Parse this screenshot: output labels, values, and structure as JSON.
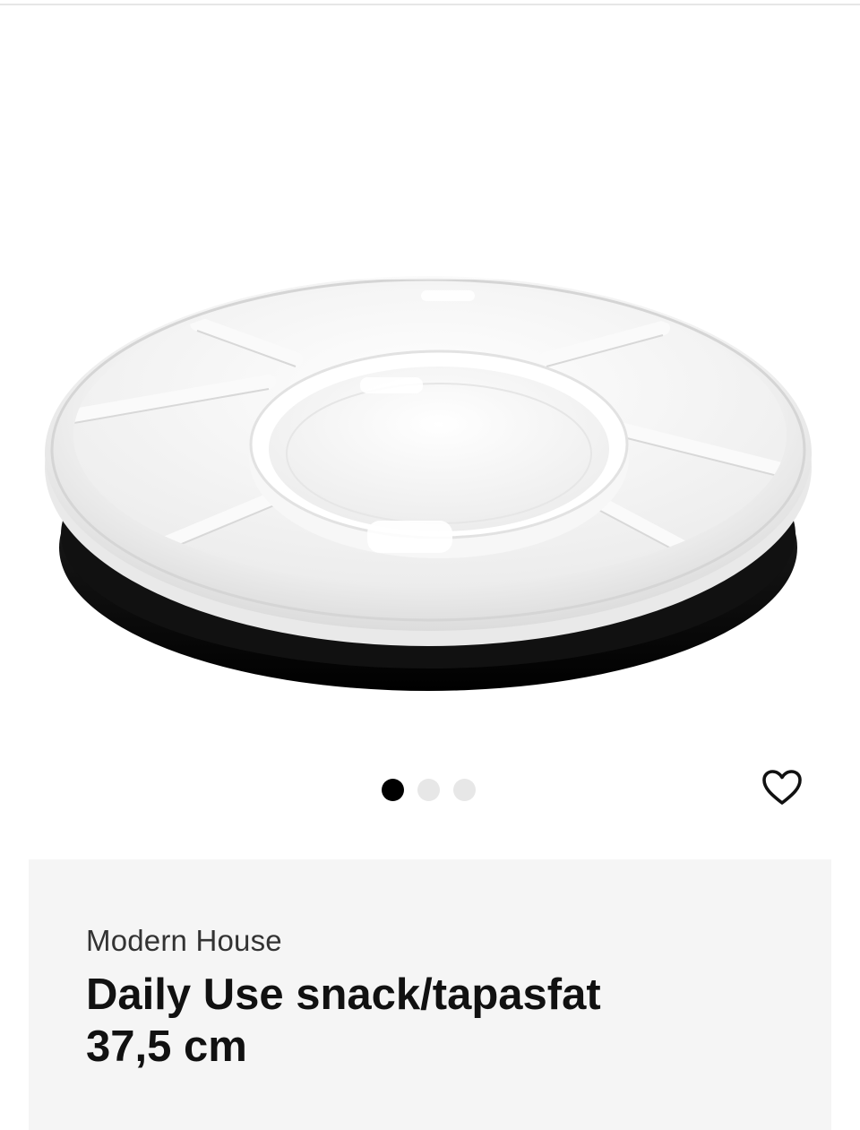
{
  "product": {
    "brand": "Modern House",
    "title_line1": "Daily Use snack/tapasfat",
    "title_line2": "37,5 cm",
    "image_alt": "Daily Use snack/tapasfat 37,5 cm"
  },
  "gallery": {
    "image_count": 3,
    "active_index": 0
  },
  "icons": {
    "favorite": "heart-outline-icon"
  },
  "colors": {
    "dot_active": "#000000",
    "dot_inactive": "#e7e7e7",
    "info_background": "#f5f5f5"
  }
}
